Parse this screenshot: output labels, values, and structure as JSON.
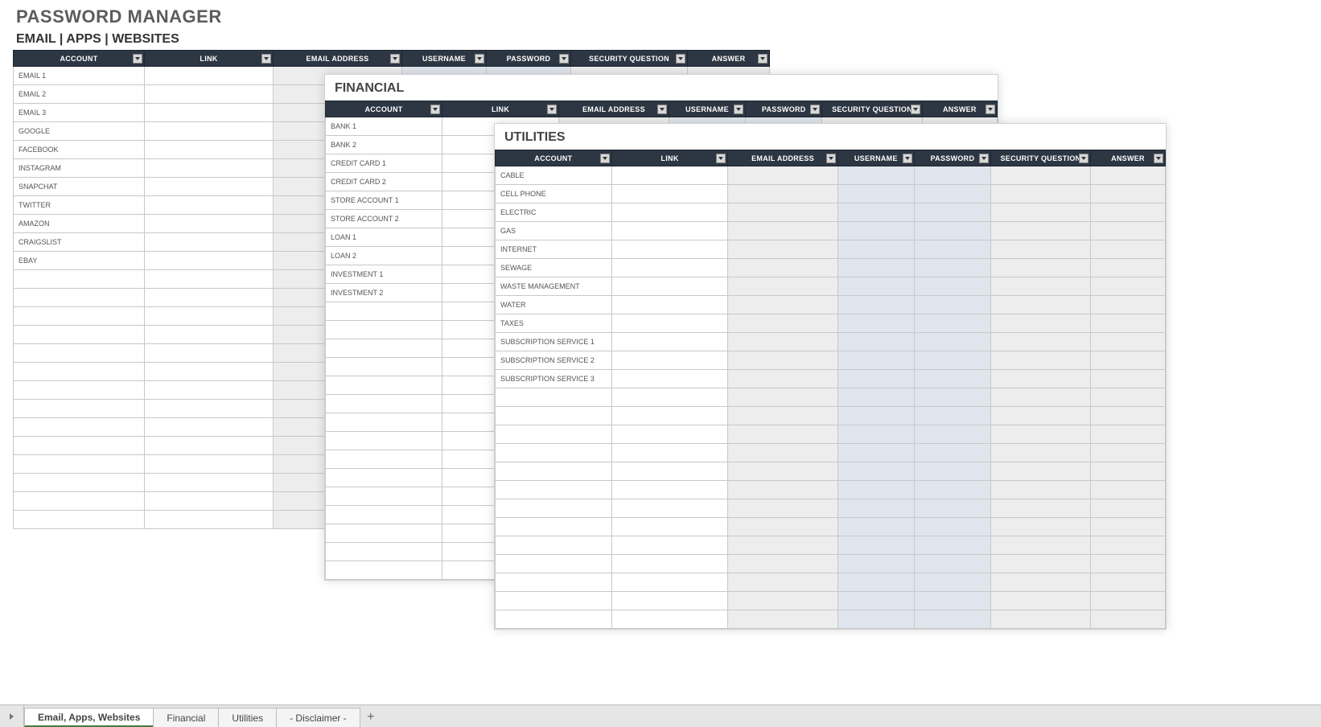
{
  "title": "PASSWORD MANAGER",
  "sheet1": {
    "subtitle": "EMAIL  |  APPS  |  WEBSITES",
    "headers": [
      "ACCOUNT",
      "LINK",
      "EMAIL ADDRESS",
      "USERNAME",
      "PASSWORD",
      "SECURITY QUESTION",
      "ANSWER"
    ],
    "rows": [
      "EMAIL 1",
      "EMAIL 2",
      "EMAIL 3",
      "GOOGLE",
      "FACEBOOK",
      "INSTAGRAM",
      "SNAPCHAT",
      "TWITTER",
      "AMAZON",
      "CRAIGSLIST",
      "EBAY"
    ],
    "blank_rows": 14
  },
  "sheet2": {
    "title": "FINANCIAL",
    "headers": [
      "ACCOUNT",
      "LINK",
      "EMAIL ADDRESS",
      "USERNAME",
      "PASSWORD",
      "SECURITY QUESTION",
      "ANSWER"
    ],
    "rows": [
      "BANK 1",
      "BANK 2",
      "CREDIT CARD 1",
      "CREDIT CARD 2",
      "STORE ACCOUNT 1",
      "STORE ACCOUNT 2",
      "LOAN 1",
      "LOAN 2",
      "INVESTMENT 1",
      "INVESTMENT 2"
    ],
    "blank_rows": 15
  },
  "sheet3": {
    "title": "UTILITIES",
    "headers": [
      "ACCOUNT",
      "LINK",
      "EMAIL ADDRESS",
      "USERNAME",
      "PASSWORD",
      "SECURITY QUESTION",
      "ANSWER"
    ],
    "rows": [
      "CABLE",
      "CELL PHONE",
      "ELECTRIC",
      "GAS",
      "INTERNET",
      "SEWAGE",
      "WASTE MANAGEMENT",
      "WATER",
      "TAXES",
      "SUBSCRIPTION SERVICE 1",
      "SUBSCRIPTION SERVICE 2",
      "SUBSCRIPTION SERVICE 3"
    ],
    "blank_rows": 13
  },
  "tabs": [
    "Email, Apps, Websites",
    "Financial",
    "Utilities",
    "- Disclaimer -"
  ],
  "active_tab": 0,
  "add_tab_label": "+"
}
